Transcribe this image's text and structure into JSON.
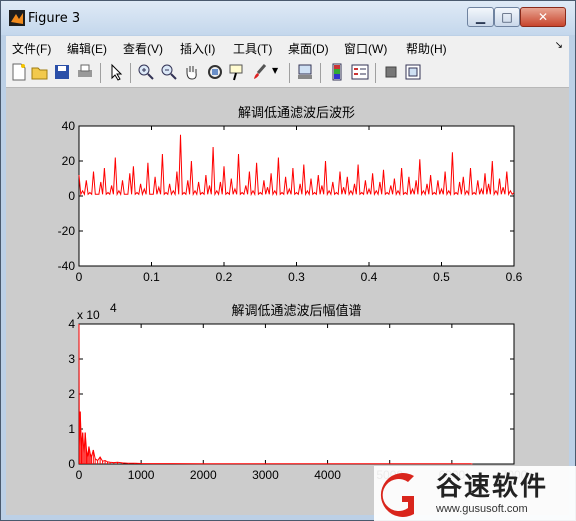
{
  "window": {
    "title": "Figure 3",
    "min_icon": "minimize-icon",
    "max_icon": "maximize-icon",
    "close_icon": "close-icon"
  },
  "menu": [
    "文件(F)",
    "编辑(E)",
    "查看(V)",
    "插入(I)",
    "工具(T)",
    "桌面(D)",
    "窗口(W)",
    "帮助(H)"
  ],
  "toolbar": [
    "new-figure-icon",
    "open-icon",
    "save-icon",
    "print-icon",
    "pointer-icon",
    "zoom-in-icon",
    "zoom-out-icon",
    "pan-icon",
    "rotate-icon",
    "data-cursor-icon",
    "brush-icon",
    "link-icon",
    "colorbar-icon",
    "legend-icon",
    "hide-plot-tools-icon",
    "show-plot-tools-icon"
  ],
  "watermark": {
    "brand": "谷速软件",
    "url": "www.gususoft.com"
  },
  "colors": {
    "line": "#ff0000",
    "figure_bg": "#cccccc",
    "axes_bg": "#ffffff"
  },
  "chart_data": [
    {
      "type": "line",
      "title": "解调低通滤波后波形",
      "xlabel": "",
      "ylabel": "",
      "xlim": [
        0,
        0.6
      ],
      "ylim": [
        -40,
        40
      ],
      "xticks": [
        "0",
        "0.1",
        "0.2",
        "0.3",
        "0.4",
        "0.5",
        "0.6"
      ],
      "yticks": [
        "40",
        "20",
        "0",
        "-20",
        "-40"
      ],
      "grid": false,
      "series": [
        {
          "x": [
            0,
            0.005,
            0.01,
            0.015,
            0.02,
            0.025,
            0.03,
            0.035,
            0.04,
            0.045,
            0.05,
            0.055,
            0.06,
            0.065,
            0.07,
            0.075,
            0.08,
            0.085,
            0.09,
            0.095,
            0.1,
            0.105,
            0.11,
            0.115,
            0.12,
            0.125,
            0.13,
            0.135,
            0.14,
            0.145,
            0.15,
            0.155,
            0.16,
            0.165,
            0.17,
            0.175,
            0.18,
            0.185,
            0.19,
            0.195,
            0.2,
            0.205,
            0.21,
            0.215,
            0.22,
            0.225,
            0.23,
            0.235,
            0.24,
            0.245,
            0.25,
            0.255,
            0.26,
            0.265,
            0.27,
            0.275,
            0.28,
            0.285,
            0.29,
            0.295,
            0.3,
            0.305,
            0.31,
            0.315,
            0.32,
            0.325,
            0.33,
            0.335,
            0.34,
            0.345,
            0.35,
            0.355,
            0.36,
            0.365,
            0.37,
            0.375,
            0.38,
            0.385,
            0.39,
            0.395,
            0.4,
            0.405,
            0.41,
            0.415,
            0.42,
            0.425,
            0.43,
            0.435,
            0.44,
            0.445,
            0.45,
            0.455,
            0.46,
            0.465,
            0.47,
            0.475,
            0.48,
            0.485,
            0.49,
            0.495,
            0.5,
            0.505,
            0.51,
            0.515,
            0.52,
            0.525,
            0.53,
            0.535,
            0.54,
            0.545,
            0.55,
            0.555,
            0.56,
            0.565,
            0.57,
            0.575,
            0.58,
            0.585,
            0.59,
            0.595,
            0.6
          ],
          "y": [
            12,
            3,
            9,
            2,
            14,
            1,
            8,
            16,
            2,
            6,
            22,
            3,
            9,
            1,
            13,
            17,
            2,
            7,
            4,
            19,
            1,
            11,
            5,
            24,
            2,
            7,
            3,
            14,
            35,
            2,
            9,
            20,
            3,
            8,
            2,
            12,
            6,
            28,
            3,
            8,
            17,
            2,
            10,
            4,
            24,
            2,
            6,
            14,
            3,
            19,
            2,
            9,
            5,
            13,
            3,
            22,
            2,
            11,
            4,
            16,
            2,
            7,
            18,
            3,
            10,
            2,
            12,
            6,
            20,
            3,
            8,
            2,
            14,
            5,
            11,
            3,
            7,
            18,
            2,
            9,
            4,
            13,
            3,
            8,
            15,
            2,
            6,
            10,
            3,
            16,
            2,
            11,
            4,
            9,
            21,
            3,
            7,
            12,
            2,
            9,
            4,
            14,
            3,
            25,
            2,
            8,
            11,
            3,
            16,
            2,
            9,
            4,
            13,
            7,
            20,
            3,
            10,
            5,
            14,
            3,
            2
          ]
        }
      ]
    },
    {
      "type": "line",
      "title": "解调低通滤波后幅值谱",
      "xlabel": "",
      "ylabel": "",
      "xlim": [
        0,
        7000
      ],
      "ylim": [
        0,
        4
      ],
      "y_multiplier": "x 10",
      "y_multiplier_exp": "4",
      "xticks": [
        "0",
        "1000",
        "2000",
        "3000",
        "4000",
        "5000",
        "6000",
        "7000"
      ],
      "yticks": [
        "4",
        "3",
        "2",
        "1",
        "0"
      ],
      "grid": false,
      "series": [
        {
          "x": [
            0,
            5,
            20,
            40,
            60,
            80,
            100,
            120,
            140,
            160,
            180,
            200,
            230,
            260,
            300,
            340,
            380,
            420,
            460,
            500,
            560,
            620,
            700,
            800,
            900,
            1000,
            1200,
            1500,
            2000,
            3000,
            4000,
            5000,
            6000,
            6300,
            6330
          ],
          "y": [
            4.0,
            0.5,
            1.5,
            0.5,
            0.9,
            0.3,
            0.9,
            0.4,
            0.2,
            0.5,
            0.3,
            0.2,
            0.4,
            0.15,
            0.1,
            0.2,
            0.08,
            0.1,
            0.06,
            0.05,
            0.04,
            0.05,
            0.03,
            0.02,
            0.02,
            0.015,
            0.01,
            0.01,
            0.008,
            0.006,
            0.005,
            0.005,
            0.005,
            0.005,
            0
          ]
        }
      ]
    }
  ]
}
